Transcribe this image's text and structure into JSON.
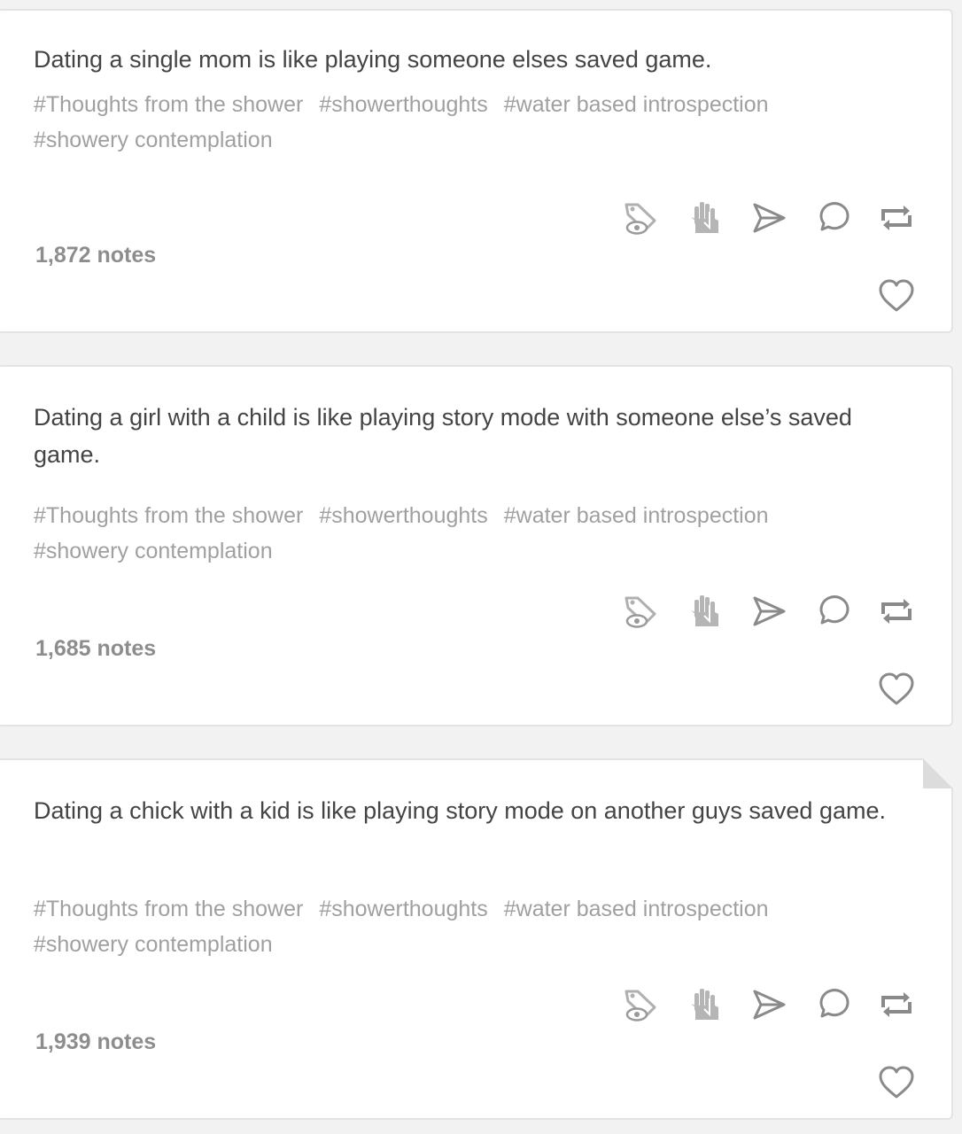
{
  "posts": [
    {
      "text": "Dating a single mom is like playing someone elses saved game.",
      "tags": [
        "#Thoughts from the shower",
        "#showerthoughts",
        "#water based introspection",
        "#showery contemplation"
      ],
      "notes": "1,872 notes"
    },
    {
      "text": "Dating a girl with a child is like playing story mode with someone else’s saved game.",
      "tags": [
        "#Thoughts from the shower",
        "#showerthoughts",
        "#water based introspection",
        "#showery contemplation"
      ],
      "notes": "1,685 notes"
    },
    {
      "text": "Dating a chick with a kid is like playing story mode on another guys saved game.",
      "tags": [
        "#Thoughts from the shower",
        "#showerthoughts",
        "#water based introspection",
        "#showery contemplation"
      ],
      "notes": "1,939 notes"
    }
  ],
  "icons": {
    "tag_view": "tag-eye-icon",
    "hand": "hand-icon",
    "share": "paper-plane-icon",
    "reply": "speech-bubble-icon",
    "reblog": "reblog-icon",
    "like": "heart-icon"
  },
  "colors": {
    "icon": "#8a8a8a",
    "icon_light": "#b5b5b5",
    "text": "#444444",
    "tags": "#a0a0a0"
  }
}
